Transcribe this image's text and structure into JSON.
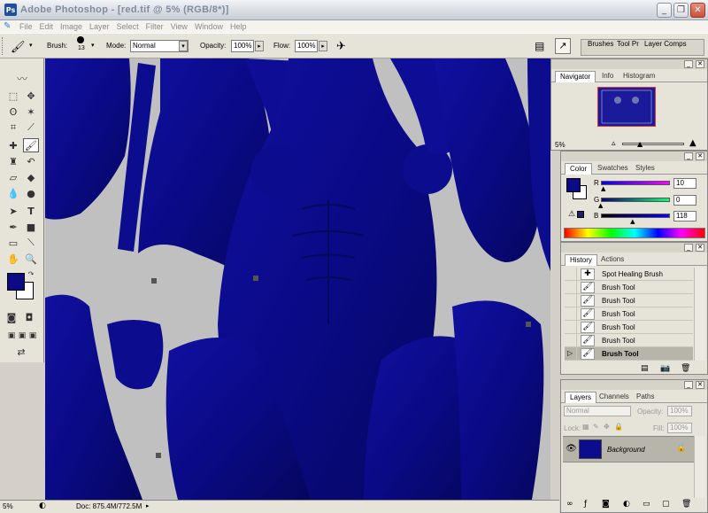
{
  "window": {
    "title": "Adobe Photoshop - [red.tif @ 5% (RGB/8*)]",
    "app_icon_label": "Ps",
    "controls": [
      "minimize",
      "restore",
      "close"
    ]
  },
  "menu": {
    "items": [
      "File",
      "Edit",
      "Image",
      "Layer",
      "Select",
      "Filter",
      "View",
      "Window",
      "Help"
    ]
  },
  "options": {
    "brush_label": "Brush:",
    "brush_size": "13",
    "mode_label": "Mode:",
    "mode_value": "Normal",
    "opacity_label": "Opacity:",
    "opacity_value": "100%",
    "flow_label": "Flow:",
    "flow_value": "100%",
    "well_tabs": [
      "Brushes",
      "Tool Pr",
      "Layer Comps"
    ]
  },
  "colors": {
    "foreground": "#0b0b85",
    "background": "#ffffff",
    "canvas_bg": "#c0c0c0",
    "skin": "#0c0c8e"
  },
  "navigator": {
    "tabs": [
      "Navigator",
      "Info",
      "Histogram"
    ],
    "zoom": "5%"
  },
  "color_panel": {
    "tabs": [
      "Color",
      "Swatches",
      "Styles"
    ],
    "r_label": "R",
    "g_label": "G",
    "b_label": "B",
    "r": "10",
    "g": "0",
    "b": "118",
    "levels": {
      "r": 10,
      "g": 0,
      "b": 118
    }
  },
  "history": {
    "tabs": [
      "History",
      "Actions"
    ],
    "items": [
      {
        "label": "Spot Healing Brush",
        "selected": false
      },
      {
        "label": "Brush Tool",
        "selected": false
      },
      {
        "label": "Brush Tool",
        "selected": false
      },
      {
        "label": "Brush Tool",
        "selected": false
      },
      {
        "label": "Brush Tool",
        "selected": false
      },
      {
        "label": "Brush Tool",
        "selected": false
      },
      {
        "label": "Brush Tool",
        "selected": true
      }
    ]
  },
  "layers": {
    "tabs": [
      "Layers",
      "Channels",
      "Paths"
    ],
    "blend_mode": "Normal",
    "opacity_label": "Opacity:",
    "opacity": "100%",
    "lock_label": "Lock:",
    "fill_label": "Fill:",
    "fill": "100%",
    "layer_name": "Background"
  },
  "status": {
    "zoom": "5%",
    "doc": "Doc: 875.4M/772.5M"
  }
}
